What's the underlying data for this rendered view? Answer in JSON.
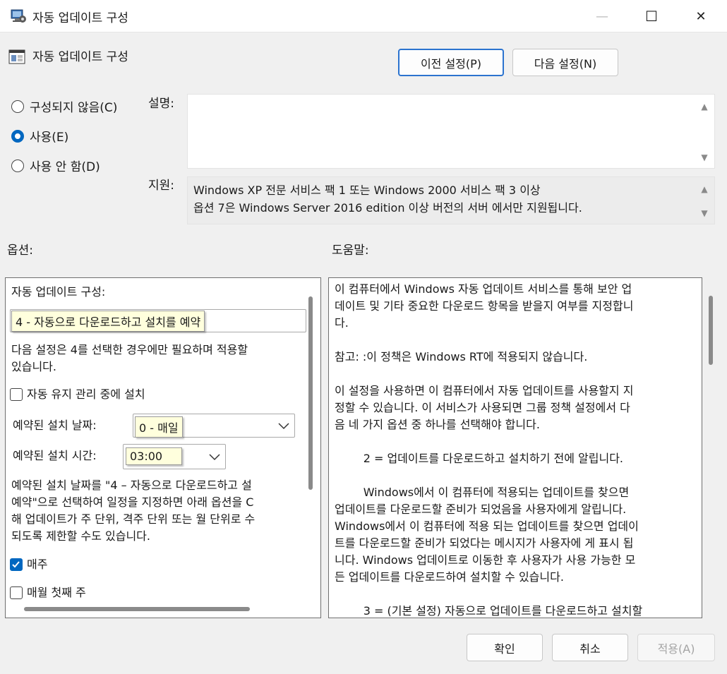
{
  "window": {
    "title": "자동 업데이트 구성",
    "minimize": "—",
    "maximize": "☐",
    "close": "✕"
  },
  "header": {
    "policy_title": "자동 업데이트 구성",
    "prev_button": "이전 설정(P)",
    "next_button": "다음 설정(N)"
  },
  "state": {
    "options": [
      {
        "label": "구성되지 않음(C)",
        "checked": false
      },
      {
        "label": "사용(E)",
        "checked": true
      },
      {
        "label": "사용 안 함(D)",
        "checked": false
      }
    ]
  },
  "description": {
    "label": "설명:",
    "text": ""
  },
  "supported": {
    "label": "지원:",
    "lines": [
      "Windows XP 전문 서비스 팩 1 또는 Windows 2000 서비스 팩 3 이상",
      "옵션 7은 Windows Server 2016 edition 이상 버전의 서버 에서만 지원됩니다."
    ]
  },
  "options_section": {
    "label": "옵션:",
    "configure_label": "자동 업데이트 구성:",
    "configure_value": "4 - 자동으로 다운로드하고 설치를 예약",
    "note": [
      "다음 설정은 4를 선택한 경우에만 필요하며 적용할",
      "있습니다."
    ],
    "maintenance_checkbox": "자동 유지 관리 중에 설치",
    "day_label": "예약된 설치 날짜:",
    "day_value": "0 - 매일",
    "time_label": "예약된 설치 시간:",
    "time_value": "03:00",
    "paragraph": [
      "예약된 설치 날짜를 \"4 – 자동으로 다운로드하고 설",
      "예약\"으로 선택하여 일정을 지정하면 아래 옵션을 C",
      "해 업데이트가 주 단위, 격주 단위 또는 월 단위로 수",
      "되도록 제한할 수도 있습니다."
    ],
    "weekly_label": "매주",
    "weekly_checked": true,
    "first_week_label": "매월 첫째 주",
    "first_week_checked": false
  },
  "help_section": {
    "label": "도움말:",
    "paragraphs": [
      "이 컴퓨터에서 Windows 자동 업데이트 서비스를 통해 보안 업\n데이트 및 기타 중요한 다운로드 항목을 받을지 여부를 지정합니\n다.",
      "참고: :이 정책은 Windows RT에 적용되지 않습니다.",
      "이 설정을 사용하면 이 컴퓨터에서 자동 업데이트를 사용할지 지\n정할 수 있습니다. 이 서비스가 사용되면 그룹 정책 설정에서 다\n음 네 가지 옵션 중 하나를 선택해야 합니다.",
      "        2 = 업데이트를 다운로드하고 설치하기 전에 알립니다.",
      "        Windows에서 이 컴퓨터에 적용되는 업데이트를 찾으면\n업데이트를 다운로드할 준비가 되었음을 사용자에게 알립니다.\nWindows에서 이 컴퓨터에 적용 되는 업데이트를 찾으면 업데이\n트를 다운로드할 준비가 되었다는 메시지가 사용자에 게 표시 됩\n니다. Windows 업데이트로 이동한 후 사용자가 사용 가능한 모\n든 업데이트를 다운로드하여 설치할 수 있습니다.",
      "        3 = (기본 설정) 자동으로 업데이트를 다운로드하고 설치할"
    ]
  },
  "footer": {
    "ok": "확인",
    "cancel": "취소",
    "apply": "적용(A)"
  },
  "colors": {
    "accent": "#0067c0",
    "primary_border": "#2b73cf"
  }
}
